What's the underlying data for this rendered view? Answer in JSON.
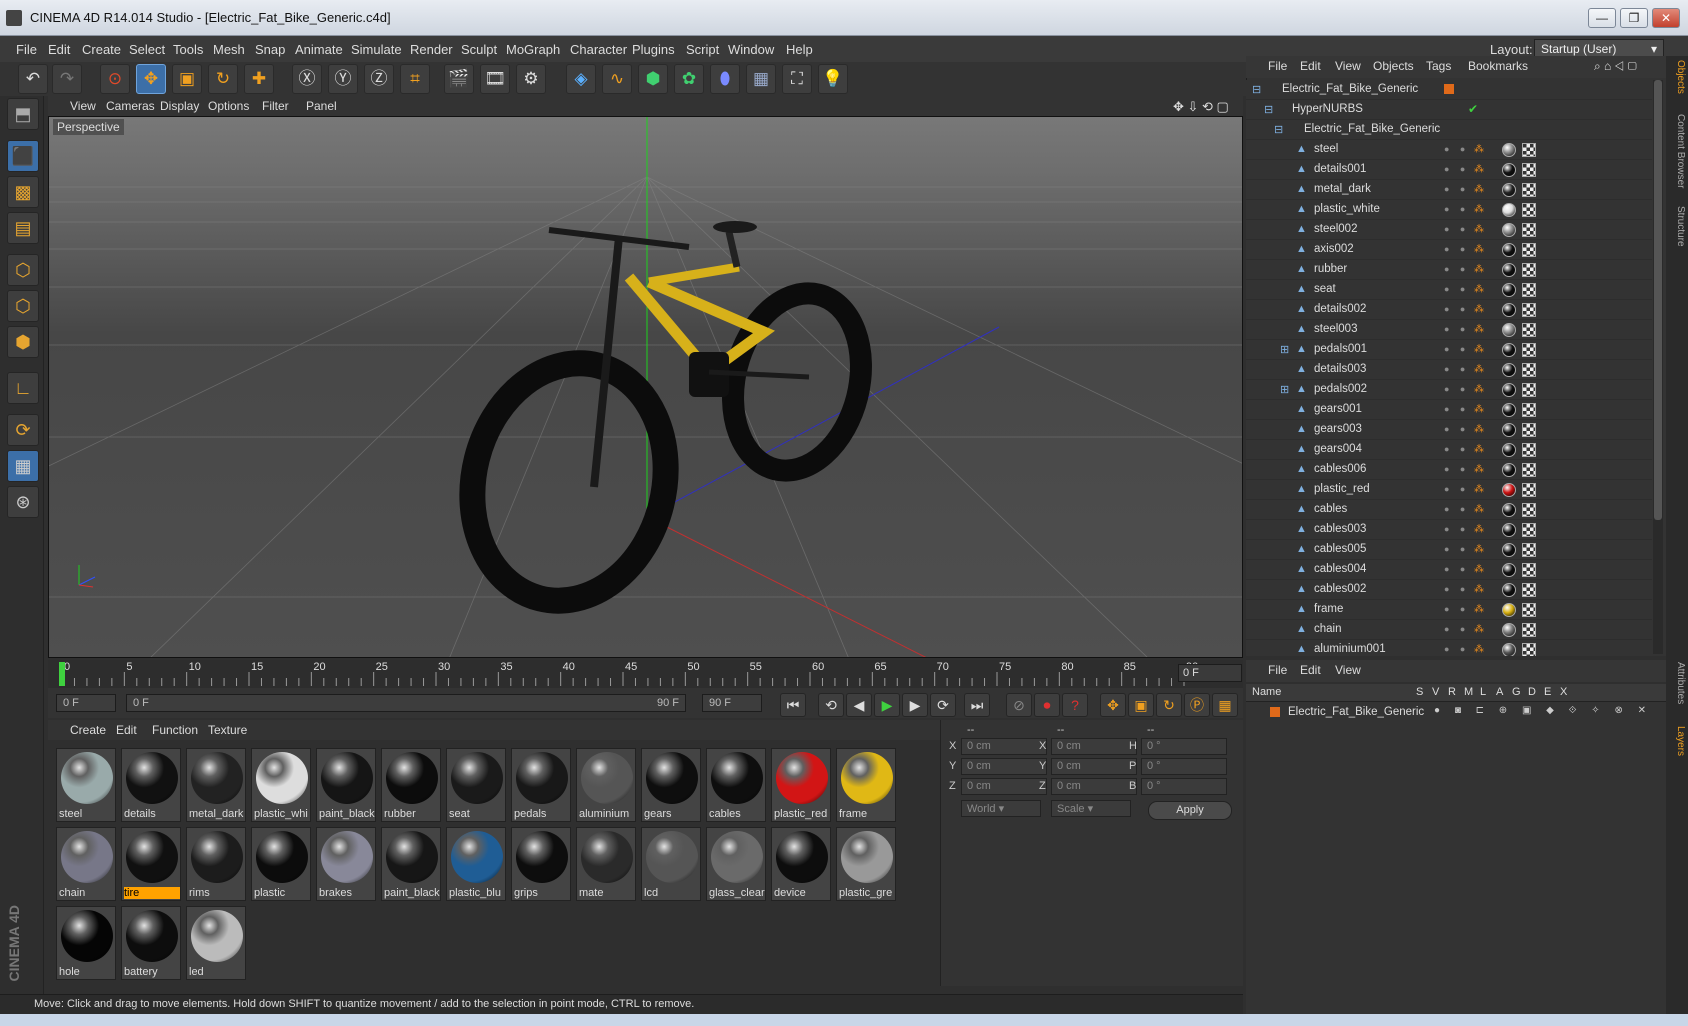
{
  "window": {
    "title": "CINEMA 4D R14.014 Studio - [Electric_Fat_Bike_Generic.c4d]"
  },
  "menu": [
    "File",
    "Edit",
    "Create",
    "Select",
    "Tools",
    "Mesh",
    "Snap",
    "Animate",
    "Simulate",
    "Render",
    "Sculpt",
    "MoGraph",
    "Character",
    "Plugins",
    "Script",
    "Window",
    "Help"
  ],
  "layout": {
    "label": "Layout:",
    "value": "Startup (User)"
  },
  "viewport": {
    "menu": [
      "View",
      "Cameras",
      "Display",
      "Options",
      "Filter",
      "Panel"
    ],
    "label": "Perspective"
  },
  "timeline": {
    "ticks": [
      "0",
      "5",
      "10",
      "15",
      "20",
      "25",
      "30",
      "35",
      "40",
      "45",
      "50",
      "55",
      "60",
      "65",
      "70",
      "75",
      "80",
      "85",
      "90"
    ],
    "frame": "0 F"
  },
  "transport": {
    "start": "0 F",
    "range_start": "0 F",
    "range_end": "90 F",
    "end": "90 F"
  },
  "materials": {
    "menu": [
      "Create",
      "Edit",
      "Function",
      "Texture"
    ],
    "items": [
      {
        "name": "steel",
        "color": "#9aa"
      },
      {
        "name": "details",
        "color": "#111"
      },
      {
        "name": "metal_dark",
        "color": "#222"
      },
      {
        "name": "plastic_whi",
        "color": "#ddd"
      },
      {
        "name": "paint_black",
        "color": "#151515"
      },
      {
        "name": "rubber",
        "color": "#0c0c0c"
      },
      {
        "name": "seat",
        "color": "#1a1a1a"
      },
      {
        "name": "pedals",
        "color": "#181818"
      },
      {
        "name": "aluminium",
        "color": "#555"
      },
      {
        "name": "gears",
        "color": "#0e0e0e"
      },
      {
        "name": "cables",
        "color": "#0e0e0e"
      },
      {
        "name": "plastic_red",
        "color": "#d21515"
      },
      {
        "name": "frame",
        "color": "#e0b815"
      },
      {
        "name": "chain",
        "color": "#778"
      },
      {
        "name": "tire",
        "color": "#101010"
      },
      {
        "name": "rims",
        "color": "#1c1c1c"
      },
      {
        "name": "plastic",
        "color": "#0c0c0c"
      },
      {
        "name": "brakes",
        "color": "#889"
      },
      {
        "name": "paint_black",
        "color": "#161616"
      },
      {
        "name": "plastic_blu",
        "color": "#1f5d95"
      },
      {
        "name": "grips",
        "color": "#0d0d0d"
      },
      {
        "name": "mate",
        "color": "#2a2a2a"
      },
      {
        "name": "lcd",
        "color": "#555"
      },
      {
        "name": "glass_clear",
        "color": "#6a6a6a"
      },
      {
        "name": "device",
        "color": "#0d0d0d"
      },
      {
        "name": "plastic_gre",
        "color": "#999"
      },
      {
        "name": "hole",
        "color": "#050505"
      },
      {
        "name": "battery",
        "color": "#0d0d0d"
      },
      {
        "name": "led",
        "color": "#bbb"
      }
    ],
    "selected": "tire"
  },
  "coords": {
    "headers": [
      "--",
      "--",
      "--"
    ],
    "rows": [
      {
        "a": "X",
        "av": "0 cm",
        "b": "X",
        "bv": "0 cm",
        "c": "H",
        "cv": "0 °"
      },
      {
        "a": "Y",
        "av": "0 cm",
        "b": "Y",
        "bv": "0 cm",
        "c": "P",
        "cv": "0 °"
      },
      {
        "a": "Z",
        "av": "0 cm",
        "b": "Z",
        "bv": "0 cm",
        "c": "B",
        "cv": "0 °"
      }
    ],
    "world": "World",
    "scale": "Scale",
    "apply": "Apply"
  },
  "status": "Move: Click and drag to move elements. Hold down SHIFT to quantize movement / add to the selection in point mode, CTRL to remove.",
  "objects": {
    "menu": [
      "File",
      "Edit",
      "View",
      "Objects",
      "Tags",
      "Bookmarks"
    ],
    "root": "Electric_Fat_Bike_Generic",
    "nurbs": "HyperNURBS",
    "group": "Electric_Fat_Bike_Generic",
    "items": [
      {
        "name": "steel",
        "ball": "#888"
      },
      {
        "name": "details001",
        "ball": "#111"
      },
      {
        "name": "metal_dark",
        "ball": "#222"
      },
      {
        "name": "plastic_white",
        "ball": "#ddd"
      },
      {
        "name": "steel002",
        "ball": "#888"
      },
      {
        "name": "axis002",
        "ball": "#111"
      },
      {
        "name": "rubber",
        "ball": "#111"
      },
      {
        "name": "seat",
        "ball": "#111"
      },
      {
        "name": "details002",
        "ball": "#111"
      },
      {
        "name": "steel003",
        "ball": "#888"
      },
      {
        "name": "pedals001",
        "ball": "#111"
      },
      {
        "name": "details003",
        "ball": "#111"
      },
      {
        "name": "pedals002",
        "ball": "#111"
      },
      {
        "name": "gears001",
        "ball": "#111"
      },
      {
        "name": "gears003",
        "ball": "#111"
      },
      {
        "name": "gears004",
        "ball": "#111"
      },
      {
        "name": "cables006",
        "ball": "#111"
      },
      {
        "name": "plastic_red",
        "ball": "#c11"
      },
      {
        "name": "cables",
        "ball": "#111"
      },
      {
        "name": "cables003",
        "ball": "#111"
      },
      {
        "name": "cables005",
        "ball": "#111"
      },
      {
        "name": "cables004",
        "ball": "#111"
      },
      {
        "name": "cables002",
        "ball": "#111"
      },
      {
        "name": "frame",
        "ball": "#d8b010"
      },
      {
        "name": "chain",
        "ball": "#777"
      },
      {
        "name": "aluminium001",
        "ball": "#555"
      }
    ]
  },
  "layers": {
    "menu": [
      "File",
      "Edit",
      "View"
    ],
    "headers": [
      "Name",
      "S",
      "V",
      "R",
      "M",
      "L",
      "A",
      "G",
      "D",
      "E",
      "X"
    ],
    "row": "Electric_Fat_Bike_Generic"
  },
  "side_tabs": [
    "Objects",
    "Content Browser",
    "Structure",
    "Attributes",
    "Layers"
  ],
  "brand": "CINEMA 4D"
}
